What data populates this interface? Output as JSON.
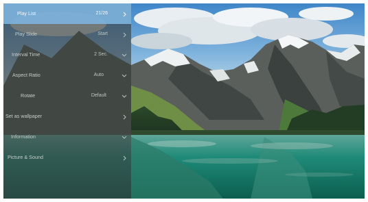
{
  "menu": {
    "items": [
      {
        "label": "Play List",
        "value": "21/26",
        "arrow": "chevron-right-icon",
        "selected": true
      },
      {
        "label": "Play Slide",
        "value": "Start",
        "arrow": "chevron-right-icon"
      },
      {
        "label": "Interval Time",
        "value": "2 Sec.",
        "arrow": "chevron-down-icon"
      },
      {
        "label": "Aspect Ratio",
        "value": "Auto",
        "arrow": "chevron-down-icon"
      },
      {
        "label": "Rotate",
        "value": "Default",
        "arrow": "chevron-down-icon"
      },
      {
        "label": "Set as wallpaper",
        "value": "",
        "arrow": "chevron-right-icon"
      },
      {
        "label": "Information",
        "value": "",
        "arrow": "chevron-down-icon"
      },
      {
        "label": "Picture & Sound",
        "value": "",
        "arrow": "chevron-right-icon"
      }
    ]
  },
  "colors": {
    "selected_highlight": "#7db2dc",
    "panel_overlay": "#3a3e3c"
  }
}
